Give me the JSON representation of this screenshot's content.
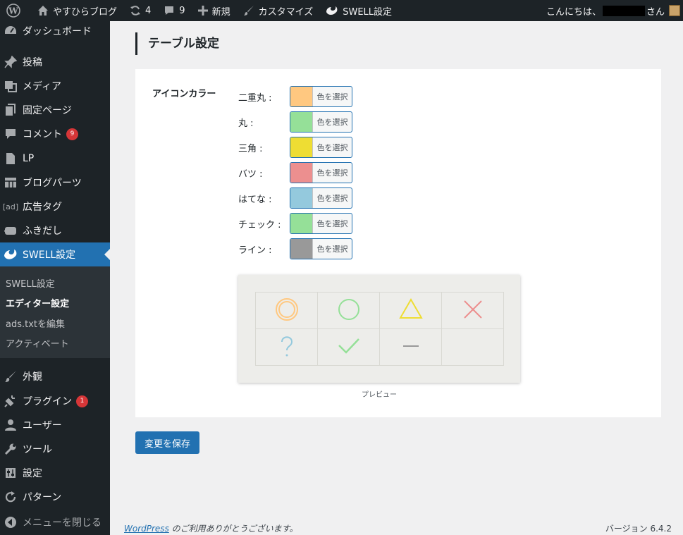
{
  "adminbar": {
    "site_name": "やすひらブログ",
    "updates_count": "4",
    "comments_count": "9",
    "new_label": "新規",
    "customize_label": "カスタマイズ",
    "swell_label": "SWELL設定",
    "greeting_prefix": "こんにちは、",
    "greeting_suffix": "さん"
  },
  "sidebar": {
    "items": [
      {
        "label": "ダッシュボード",
        "icon": "dashboard-icon"
      },
      {
        "label": "投稿",
        "icon": "pin-icon"
      },
      {
        "label": "メディア",
        "icon": "media-icon"
      },
      {
        "label": "固定ページ",
        "icon": "page-icon"
      },
      {
        "label": "コメント",
        "icon": "comment-icon",
        "badge": "9"
      },
      {
        "label": "LP",
        "icon": "document-icon"
      },
      {
        "label": "ブログパーツ",
        "icon": "grid-icon"
      },
      {
        "label": "広告タグ",
        "icon": "ad-icon",
        "icon_text": "[ad]"
      },
      {
        "label": "ふきだし",
        "icon": "speech-bubble-icon"
      },
      {
        "label": "SWELL設定",
        "icon": "swell-icon"
      },
      {
        "label": "外観",
        "icon": "brush-icon"
      },
      {
        "label": "プラグイン",
        "icon": "plugin-icon",
        "badge": "1"
      },
      {
        "label": "ユーザー",
        "icon": "user-icon"
      },
      {
        "label": "ツール",
        "icon": "wrench-icon"
      },
      {
        "label": "設定",
        "icon": "settings-icon"
      },
      {
        "label": "パターン",
        "icon": "refresh-icon"
      },
      {
        "label": "メニューを閉じる",
        "icon": "collapse-icon"
      }
    ],
    "submenu": [
      "SWELL設定",
      "エディター設定",
      "ads.txtを編集",
      "アクティベート"
    ]
  },
  "main": {
    "page_title": "テーブル設定",
    "field_label": "アイコンカラー",
    "picker_label": "色を選択",
    "colors": [
      {
        "label": "二重丸 :",
        "color": "#ffc880"
      },
      {
        "label": "丸 :",
        "color": "#95e098"
      },
      {
        "label": "三角 :",
        "color": "#eedd33"
      },
      {
        "label": "バツ :",
        "color": "#ec8f8f"
      },
      {
        "label": "はてな :",
        "color": "#94c9dd"
      },
      {
        "label": "チェック :",
        "color": "#95e098"
      },
      {
        "label": "ライン :",
        "color": "#999999"
      }
    ],
    "preview_label": "プレビュー",
    "save_button": "変更を保存"
  },
  "footer": {
    "wp_link": "WordPress",
    "thanks": " のご利用ありがとうございます。",
    "version": "バージョン 6.4.2"
  }
}
